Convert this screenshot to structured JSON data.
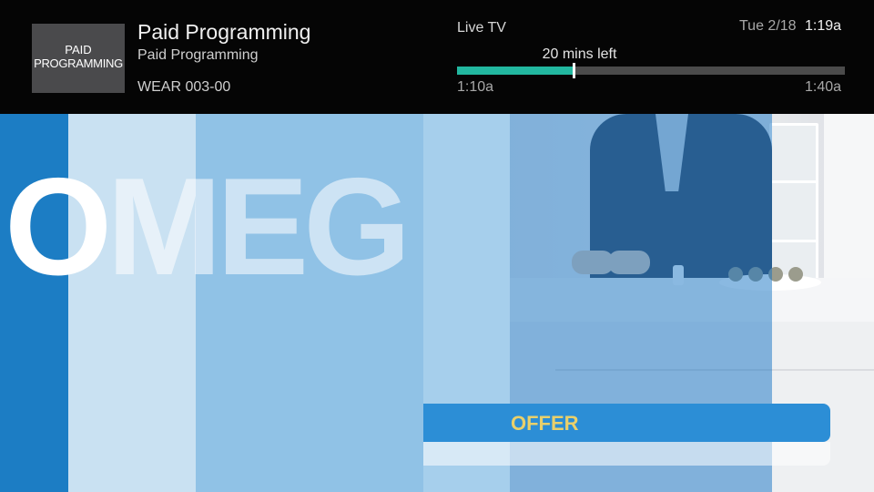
{
  "program": {
    "logo_line1": "PAID",
    "logo_line2": "PROGRAMMING",
    "title": "Paid Programming",
    "episode_title": "Paid Programming",
    "channel": "WEAR 003-00"
  },
  "status": {
    "mode": "Live TV",
    "date": "Tue 2/18",
    "time": "1:19a",
    "remaining": "20 mins left",
    "start_time": "1:10a",
    "end_time": "1:40a",
    "progress_fraction": 0.3,
    "progress_color": "#22b8a0"
  },
  "video": {
    "brand_first_letter": "O",
    "brand_rest": "MEG",
    "offer_text": "OFFER",
    "overlay_color": "#1c7dc4"
  }
}
